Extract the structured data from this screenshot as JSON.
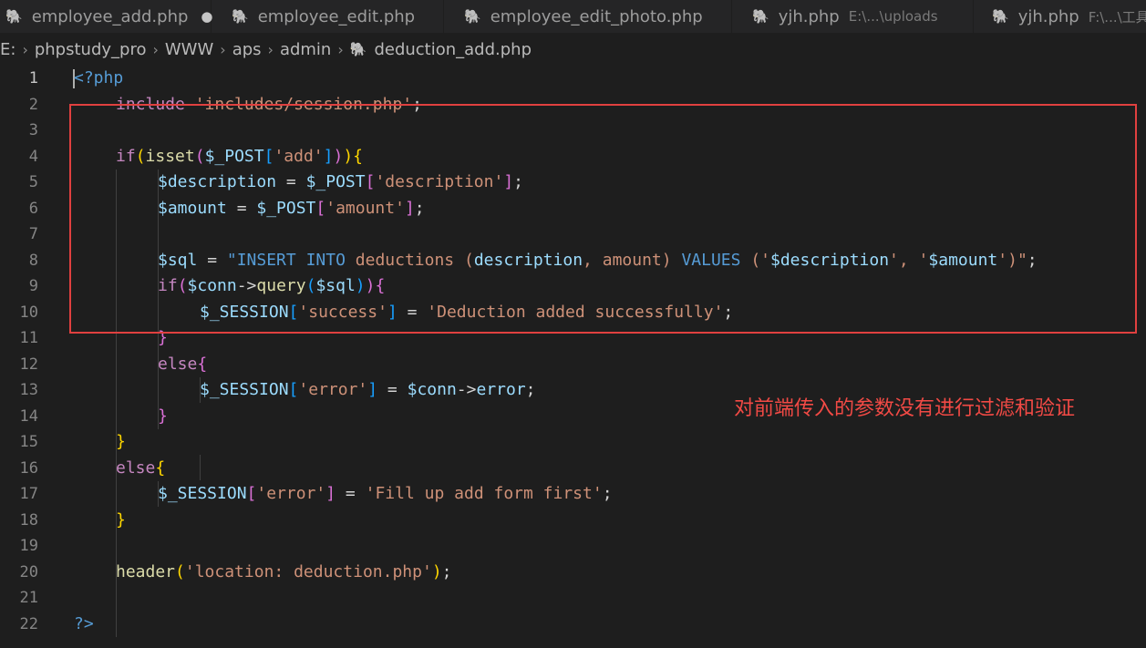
{
  "tabs": [
    {
      "label": "employee_add.php",
      "modified": "●"
    },
    {
      "label": "employee_edit.php"
    },
    {
      "label": "employee_edit_photo.php"
    },
    {
      "label": "yjh.php",
      "path": "E:\\...\\uploads"
    },
    {
      "label": "yjh.php",
      "path": "F:\\...\\工具"
    }
  ],
  "breadcrumb": {
    "items": [
      "E:",
      "phpstudy_pro",
      "WWW",
      "aps",
      "admin"
    ],
    "file": "deduction_add.php"
  },
  "line_numbers": [
    "1",
    "2",
    "3",
    "4",
    "5",
    "6",
    "7",
    "8",
    "9",
    "10",
    "11",
    "12",
    "13",
    "14",
    "15",
    "16",
    "17",
    "18",
    "19",
    "20",
    "21",
    "22"
  ],
  "code": {
    "l1": [
      "<?php"
    ],
    "l2": [
      "include",
      " ",
      "'includes/session.php'",
      ";"
    ],
    "l4": [
      "if",
      "(",
      "isset",
      "(",
      "$_POST",
      "[",
      "'add'",
      "]",
      ")",
      ")",
      "{"
    ],
    "l5": [
      "$description",
      " = ",
      "$_POST",
      "[",
      "'description'",
      "]",
      ";"
    ],
    "l6": [
      "$amount",
      " = ",
      "$_POST",
      "[",
      "'amount'",
      "]",
      ";"
    ],
    "l8": [
      "$sql",
      " = ",
      "\"INSERT INTO ",
      "deductions",
      " ",
      "(",
      "description",
      ", ",
      "amount",
      ")",
      " VALUES ",
      "(",
      "'",
      "$description",
      "', '",
      "$amount",
      "'",
      ")",
      "\"",
      ";"
    ],
    "l9": [
      "if",
      "(",
      "$conn",
      "->",
      "query",
      "(",
      "$sql",
      ")",
      ")",
      "{"
    ],
    "l10": [
      "$_SESSION",
      "[",
      "'success'",
      "]",
      " = ",
      "'Deduction added successfully'",
      ";"
    ],
    "l11": [
      "}"
    ],
    "l12": [
      "else",
      "{"
    ],
    "l13": [
      "$_SESSION",
      "[",
      "'error'",
      "]",
      " = ",
      "$conn",
      "->",
      "error",
      ";"
    ],
    "l14": [
      "}"
    ],
    "l15": [
      "}"
    ],
    "l16": [
      "else",
      "{"
    ],
    "l17": [
      "$_SESSION",
      "[",
      "'error'",
      "]",
      " = ",
      "'Fill up add form first'",
      ";"
    ],
    "l18": [
      "}"
    ],
    "l20": [
      "header",
      "(",
      "'location: deduction.php'",
      ")",
      ";"
    ],
    "l22": [
      "?>"
    ]
  },
  "annotation": "对前端传入的参数没有进行过滤和验证",
  "colors": {
    "highlight_box": "#e0403f",
    "annotation_text": "#f24a45",
    "editor_bg": "#1e1e1e"
  },
  "icons": [
    "php-elephant-icon",
    "chevron-right-icon",
    "unsaved-dot-icon"
  ]
}
